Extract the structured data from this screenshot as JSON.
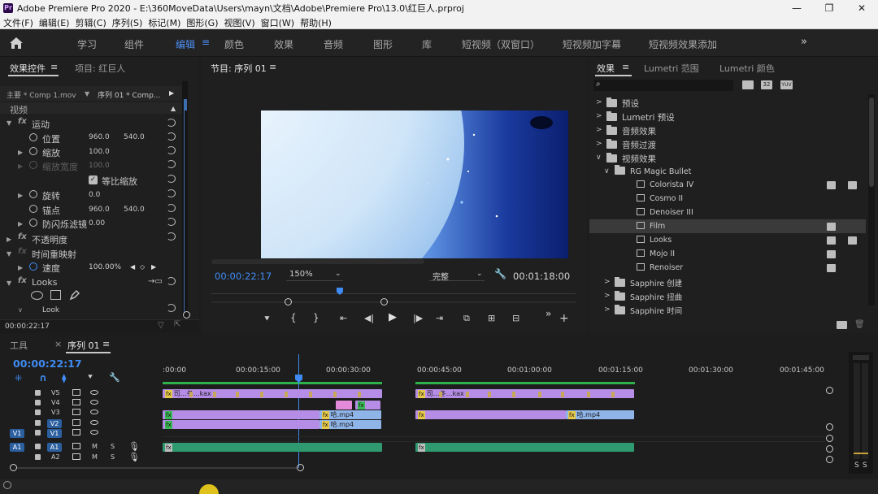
{
  "titlebar": {
    "app_icon": "Pr",
    "title": "Adobe Premiere Pro 2020 - E:\\360MoveData\\Users\\mayn\\文档\\Adobe\\Premiere Pro\\13.0\\红巨人.prproj",
    "controls": [
      "—",
      "❐",
      "✕"
    ]
  },
  "menubar": [
    "文件(F)",
    "编辑(E)",
    "剪辑(C)",
    "序列(S)",
    "标记(M)",
    "图形(G)",
    "视图(V)",
    "窗口(W)",
    "帮助(H)"
  ],
  "workspaces": [
    "学习",
    "组件",
    "编辑",
    "颜色",
    "效果",
    "音频",
    "图形",
    "库",
    "短视频（双窗口）",
    "短视频加字幕",
    "短视频效果添加"
  ],
  "active_workspace": "编辑",
  "effect_controls": {
    "tab_active": "效果控件",
    "tab_other": "项目: 红巨人",
    "master_label": "主要 * Comp 1.mov",
    "sequence_label": "序列 01 * Comp...",
    "section_video": "视频",
    "motion": "运动",
    "position_label": "位置",
    "position_x": "960.0",
    "position_y": "540.0",
    "scale_label": "缩放",
    "scale_value": "100.0",
    "scale_width_label": "缩放宽度",
    "scale_width_value": "100.0",
    "uniform_scale": "等比缩放",
    "rotation_label": "旋转",
    "rotation_value": "0.0",
    "anchor_label": "锚点",
    "anchor_x": "960.0",
    "anchor_y": "540.0",
    "antiflicker_label": "防闪烁滤镜",
    "antiflicker_value": "0.00",
    "opacity": "不透明度",
    "time_remap": "时间重映射",
    "speed_label": "速度",
    "speed_value": "100.00%",
    "looks": "Looks",
    "look_label": "Look",
    "timecode": "00:00:22:17"
  },
  "program": {
    "title": "节目: 序列 01",
    "timecode": "00:00:22:17",
    "zoom": "150%",
    "quality": "完整",
    "duration": "00:01:18:00",
    "colors": {
      "sky_light": "#d8ecfb",
      "sky_dark": "#0b1f6e"
    }
  },
  "effects_panel": {
    "tabs": [
      "效果",
      "Lumetri 范围",
      "Lumetri 颜色"
    ],
    "search_placeholder": "",
    "filter_icons": [
      "32",
      "YUV"
    ],
    "items": [
      {
        "label": "预设",
        "level": 0,
        "kind": "folder",
        "expanded": false
      },
      {
        "label": "Lumetri 预设",
        "level": 0,
        "kind": "folder",
        "expanded": false
      },
      {
        "label": "音频效果",
        "level": 0,
        "kind": "folder",
        "expanded": false
      },
      {
        "label": "音频过渡",
        "level": 0,
        "kind": "folder",
        "expanded": false
      },
      {
        "label": "视频效果",
        "level": 0,
        "kind": "folder",
        "expanded": true
      },
      {
        "label": "RG Magic Bullet",
        "level": 1,
        "kind": "folder",
        "expanded": true
      },
      {
        "label": "Colorista IV",
        "level": 2,
        "kind": "effect",
        "badges": 2
      },
      {
        "label": "Cosmo II",
        "level": 2,
        "kind": "effect",
        "badges": 0
      },
      {
        "label": "Denoiser III",
        "level": 2,
        "kind": "effect",
        "badges": 0
      },
      {
        "label": "Film",
        "level": 2,
        "kind": "effect",
        "badges": 1,
        "selected": true
      },
      {
        "label": "Looks",
        "level": 2,
        "kind": "effect",
        "badges": 2
      },
      {
        "label": "Mojo II",
        "level": 2,
        "kind": "effect",
        "badges": 1
      },
      {
        "label": "Renoiser",
        "level": 2,
        "kind": "effect",
        "badges": 1
      },
      {
        "label": "Sapphire 创建",
        "level": 1,
        "kind": "folder",
        "expanded": false
      },
      {
        "label": "Sapphire 扭曲",
        "level": 1,
        "kind": "folder",
        "expanded": false
      },
      {
        "label": "Sapphire 时间",
        "level": 1,
        "kind": "folder",
        "expanded": false
      }
    ]
  },
  "timeline": {
    "tools_tab": "工具",
    "sequence_tab": "序列 01",
    "timecode": "00:00:22:17",
    "ruler": [
      ":00:00",
      "00:00:15:00",
      "00:00:30:00",
      "00:00:45:00",
      "00:01:00:00",
      "00:01:15:00",
      "00:01:30:00",
      "00:01:45:00"
    ],
    "tracks": [
      {
        "name": "V5",
        "src": ""
      },
      {
        "name": "V4",
        "src": ""
      },
      {
        "name": "V3",
        "src": ""
      },
      {
        "name": "V2",
        "src": ""
      },
      {
        "name": "V1",
        "src": "V1"
      },
      {
        "name": "A1",
        "src": "A1"
      },
      {
        "name": "A2",
        "src": ""
      }
    ],
    "clips": {
      "v5_a": "司…冬…kax",
      "v5_b": "司…冬…kax",
      "v3_b": "哈.mp4",
      "v2_a": "哈.mp4",
      "v3_c": "哈.mp4"
    },
    "audio_meter_labels": [
      "S",
      "S"
    ]
  }
}
